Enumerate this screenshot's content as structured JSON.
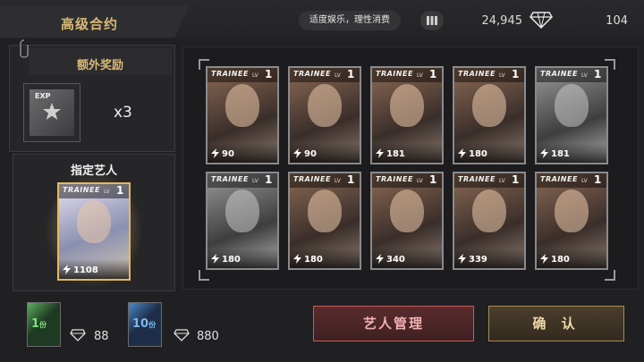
{
  "header": {
    "title": "高级合约",
    "notice": "适度娱乐，理性消费",
    "currency_amount": "24,945",
    "right_count": "104"
  },
  "bonus": {
    "title": "额外奖励",
    "item_label": "EXP",
    "multiplier": "x3"
  },
  "designated_artist": {
    "title": "指定艺人",
    "card": {
      "brand": "TRAINEE",
      "lv_label": "LV",
      "level": "1",
      "power": "1108"
    }
  },
  "cards": [
    {
      "brand": "TRAINEE",
      "lv_label": "LV",
      "level": "1",
      "power": "90"
    },
    {
      "brand": "TRAINEE",
      "lv_label": "LV",
      "level": "1",
      "power": "90"
    },
    {
      "brand": "TRAINEE",
      "lv_label": "LV",
      "level": "1",
      "power": "181"
    },
    {
      "brand": "TRAINEE",
      "lv_label": "LV",
      "level": "1",
      "power": "180"
    },
    {
      "brand": "TRAINEE",
      "lv_label": "LV",
      "level": "1",
      "power": "181"
    },
    {
      "brand": "TRAINEE",
      "lv_label": "LV",
      "level": "1",
      "power": "180"
    },
    {
      "brand": "TRAINEE",
      "lv_label": "LV",
      "level": "1",
      "power": "180"
    },
    {
      "brand": "TRAINEE",
      "lv_label": "LV",
      "level": "1",
      "power": "340"
    },
    {
      "brand": "TRAINEE",
      "lv_label": "LV",
      "level": "1",
      "power": "339"
    },
    {
      "brand": "TRAINEE",
      "lv_label": "LV",
      "level": "1",
      "power": "180"
    }
  ],
  "purchase": {
    "single": {
      "count": "1",
      "unit": "份",
      "price": "88"
    },
    "ten": {
      "count": "10",
      "unit": "份",
      "price": "880"
    }
  },
  "buttons": {
    "artist_management": "艺人管理",
    "confirm": "确 认"
  },
  "colors": {
    "accent_gold": "#d8b877",
    "danger_border": "#c85a5a",
    "confirm_border": "#a88a5a"
  }
}
